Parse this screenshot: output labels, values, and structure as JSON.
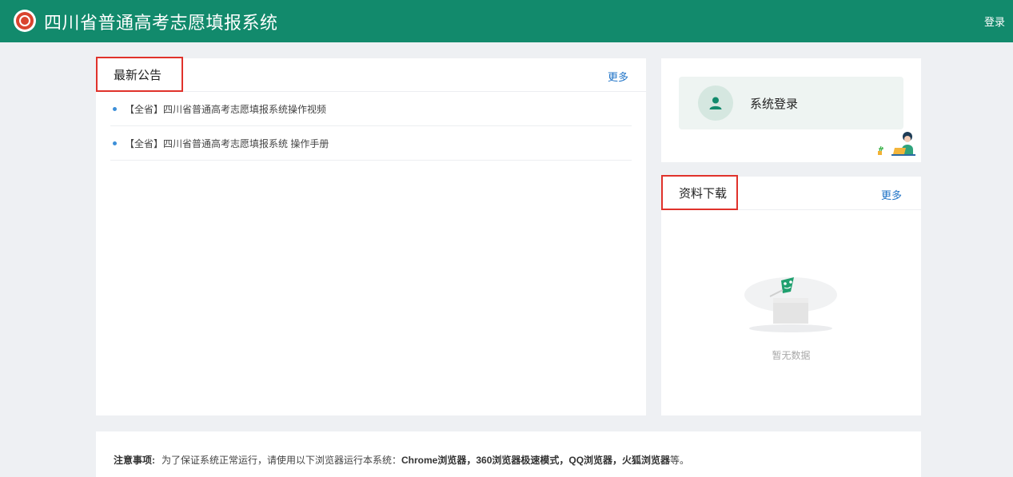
{
  "header": {
    "title": "四川省普通高考志愿填报系统",
    "login_label": "登录",
    "logo_icon": "school-emblem-icon",
    "bg_color": "#128a6c"
  },
  "news": {
    "title": "最新公告",
    "more_label": "更多",
    "items": [
      {
        "label": "【全省】四川省普通高考志愿填报系统操作视频"
      },
      {
        "label": "【全省】四川省普通高考志愿填报系统 操作手册"
      }
    ]
  },
  "login_panel": {
    "label": "系统登录",
    "icon": "user-icon"
  },
  "downloads": {
    "title": "资料下载",
    "more_label": "更多",
    "empty_text": "暂无数据",
    "empty_icon": "empty-box-icon"
  },
  "notice": {
    "label": "注意事项:",
    "text_prefix": "为了保证系统正常运行，请使用以下浏览器运行本系统：",
    "browsers": "Chrome浏览器，360浏览器极速模式，QQ浏览器，火狐浏览器",
    "text_suffix": "等。"
  },
  "colors": {
    "accent": "#128a6c",
    "highlight_border": "#e0322b",
    "link": "#1f73c7"
  }
}
